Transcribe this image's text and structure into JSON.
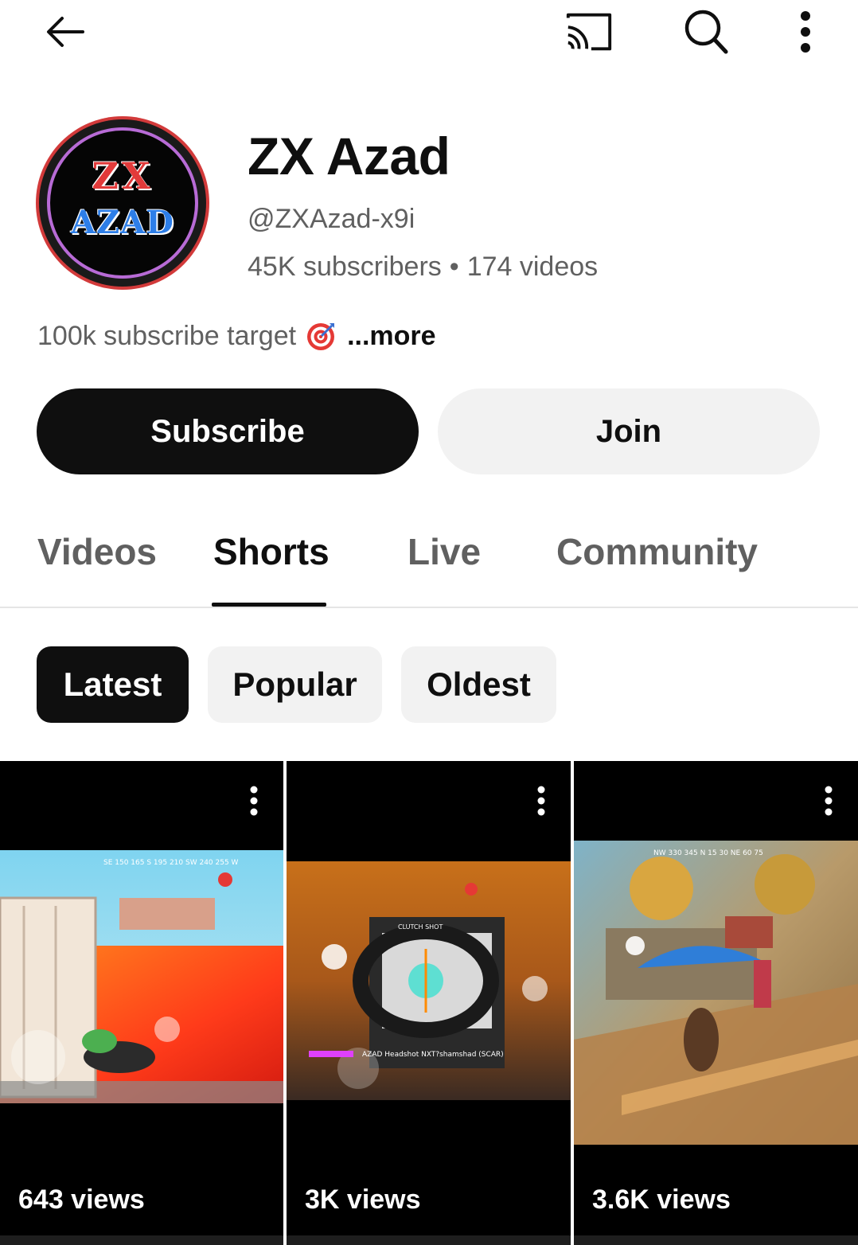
{
  "topbar": {
    "back_icon": "arrow-left-icon",
    "cast_icon": "cast-icon",
    "search_icon": "search-icon",
    "more_icon": "more-vertical-icon"
  },
  "channel": {
    "avatar_text_line1": "ZX",
    "avatar_text_line2": "AZAD",
    "name": "ZX Azad",
    "handle": "@ZXAzad-x9i",
    "subscribers": "45K subscribers",
    "separator": "•",
    "videos": "174 videos",
    "description": "100k subscribe target",
    "description_icon": "target-emoji-icon",
    "more_label": "...more"
  },
  "actions": {
    "subscribe_label": "Subscribe",
    "join_label": "Join"
  },
  "tabs": [
    {
      "label": "Videos",
      "active": false
    },
    {
      "label": "Shorts",
      "active": true
    },
    {
      "label": "Live",
      "active": false
    },
    {
      "label": "Community",
      "active": false
    }
  ],
  "sort_chips": [
    {
      "label": "Latest",
      "selected": true
    },
    {
      "label": "Popular",
      "selected": false
    },
    {
      "label": "Oldest",
      "selected": false
    }
  ],
  "shorts": [
    {
      "views": "643 views"
    },
    {
      "views": "3K views"
    },
    {
      "views": "3.6K views"
    }
  ],
  "colors": {
    "primary_text": "#0f0f0f",
    "secondary_text": "#606060",
    "chip_bg": "#f2f2f2",
    "avatar_red": "#d23a3a",
    "avatar_blue": "#2d7ee8"
  }
}
